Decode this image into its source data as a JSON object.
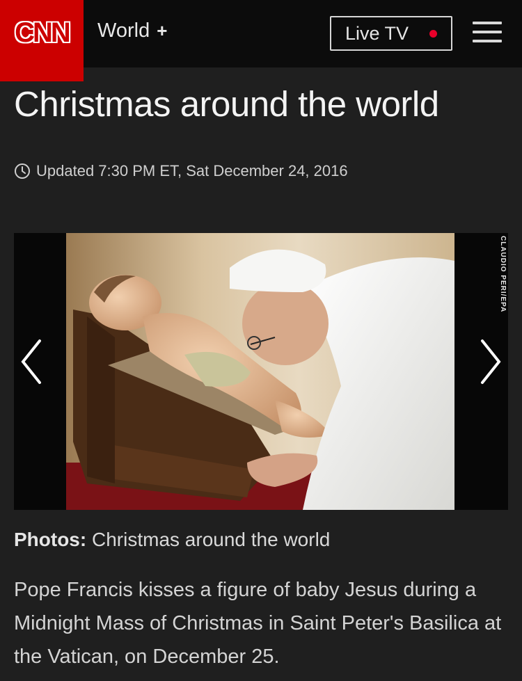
{
  "brand": {
    "logo_text": "CNN",
    "accent_color": "#cc0000",
    "top_stripe_color": "#f2a03d"
  },
  "header": {
    "section": "World",
    "section_expand": "+",
    "live_label": "Live TV",
    "live_dot_color": "#e8002a",
    "menu_icon": "hamburger-icon"
  },
  "article": {
    "title": "Christmas around the world",
    "updated": "Updated 7:30 PM ET, Sat December 24, 2016"
  },
  "gallery": {
    "photo_credit": "CLAUDIO PERI/EPA",
    "prev_icon": "chevron-left-icon",
    "next_icon": "chevron-right-icon",
    "caption_label": "Photos:",
    "caption_title": "Christmas around the world",
    "caption_text": "Pope Francis kisses a figure of baby Jesus during a Midnight Mass of Christmas in Saint Peter's Basilica at the Vatican, on December 25."
  }
}
